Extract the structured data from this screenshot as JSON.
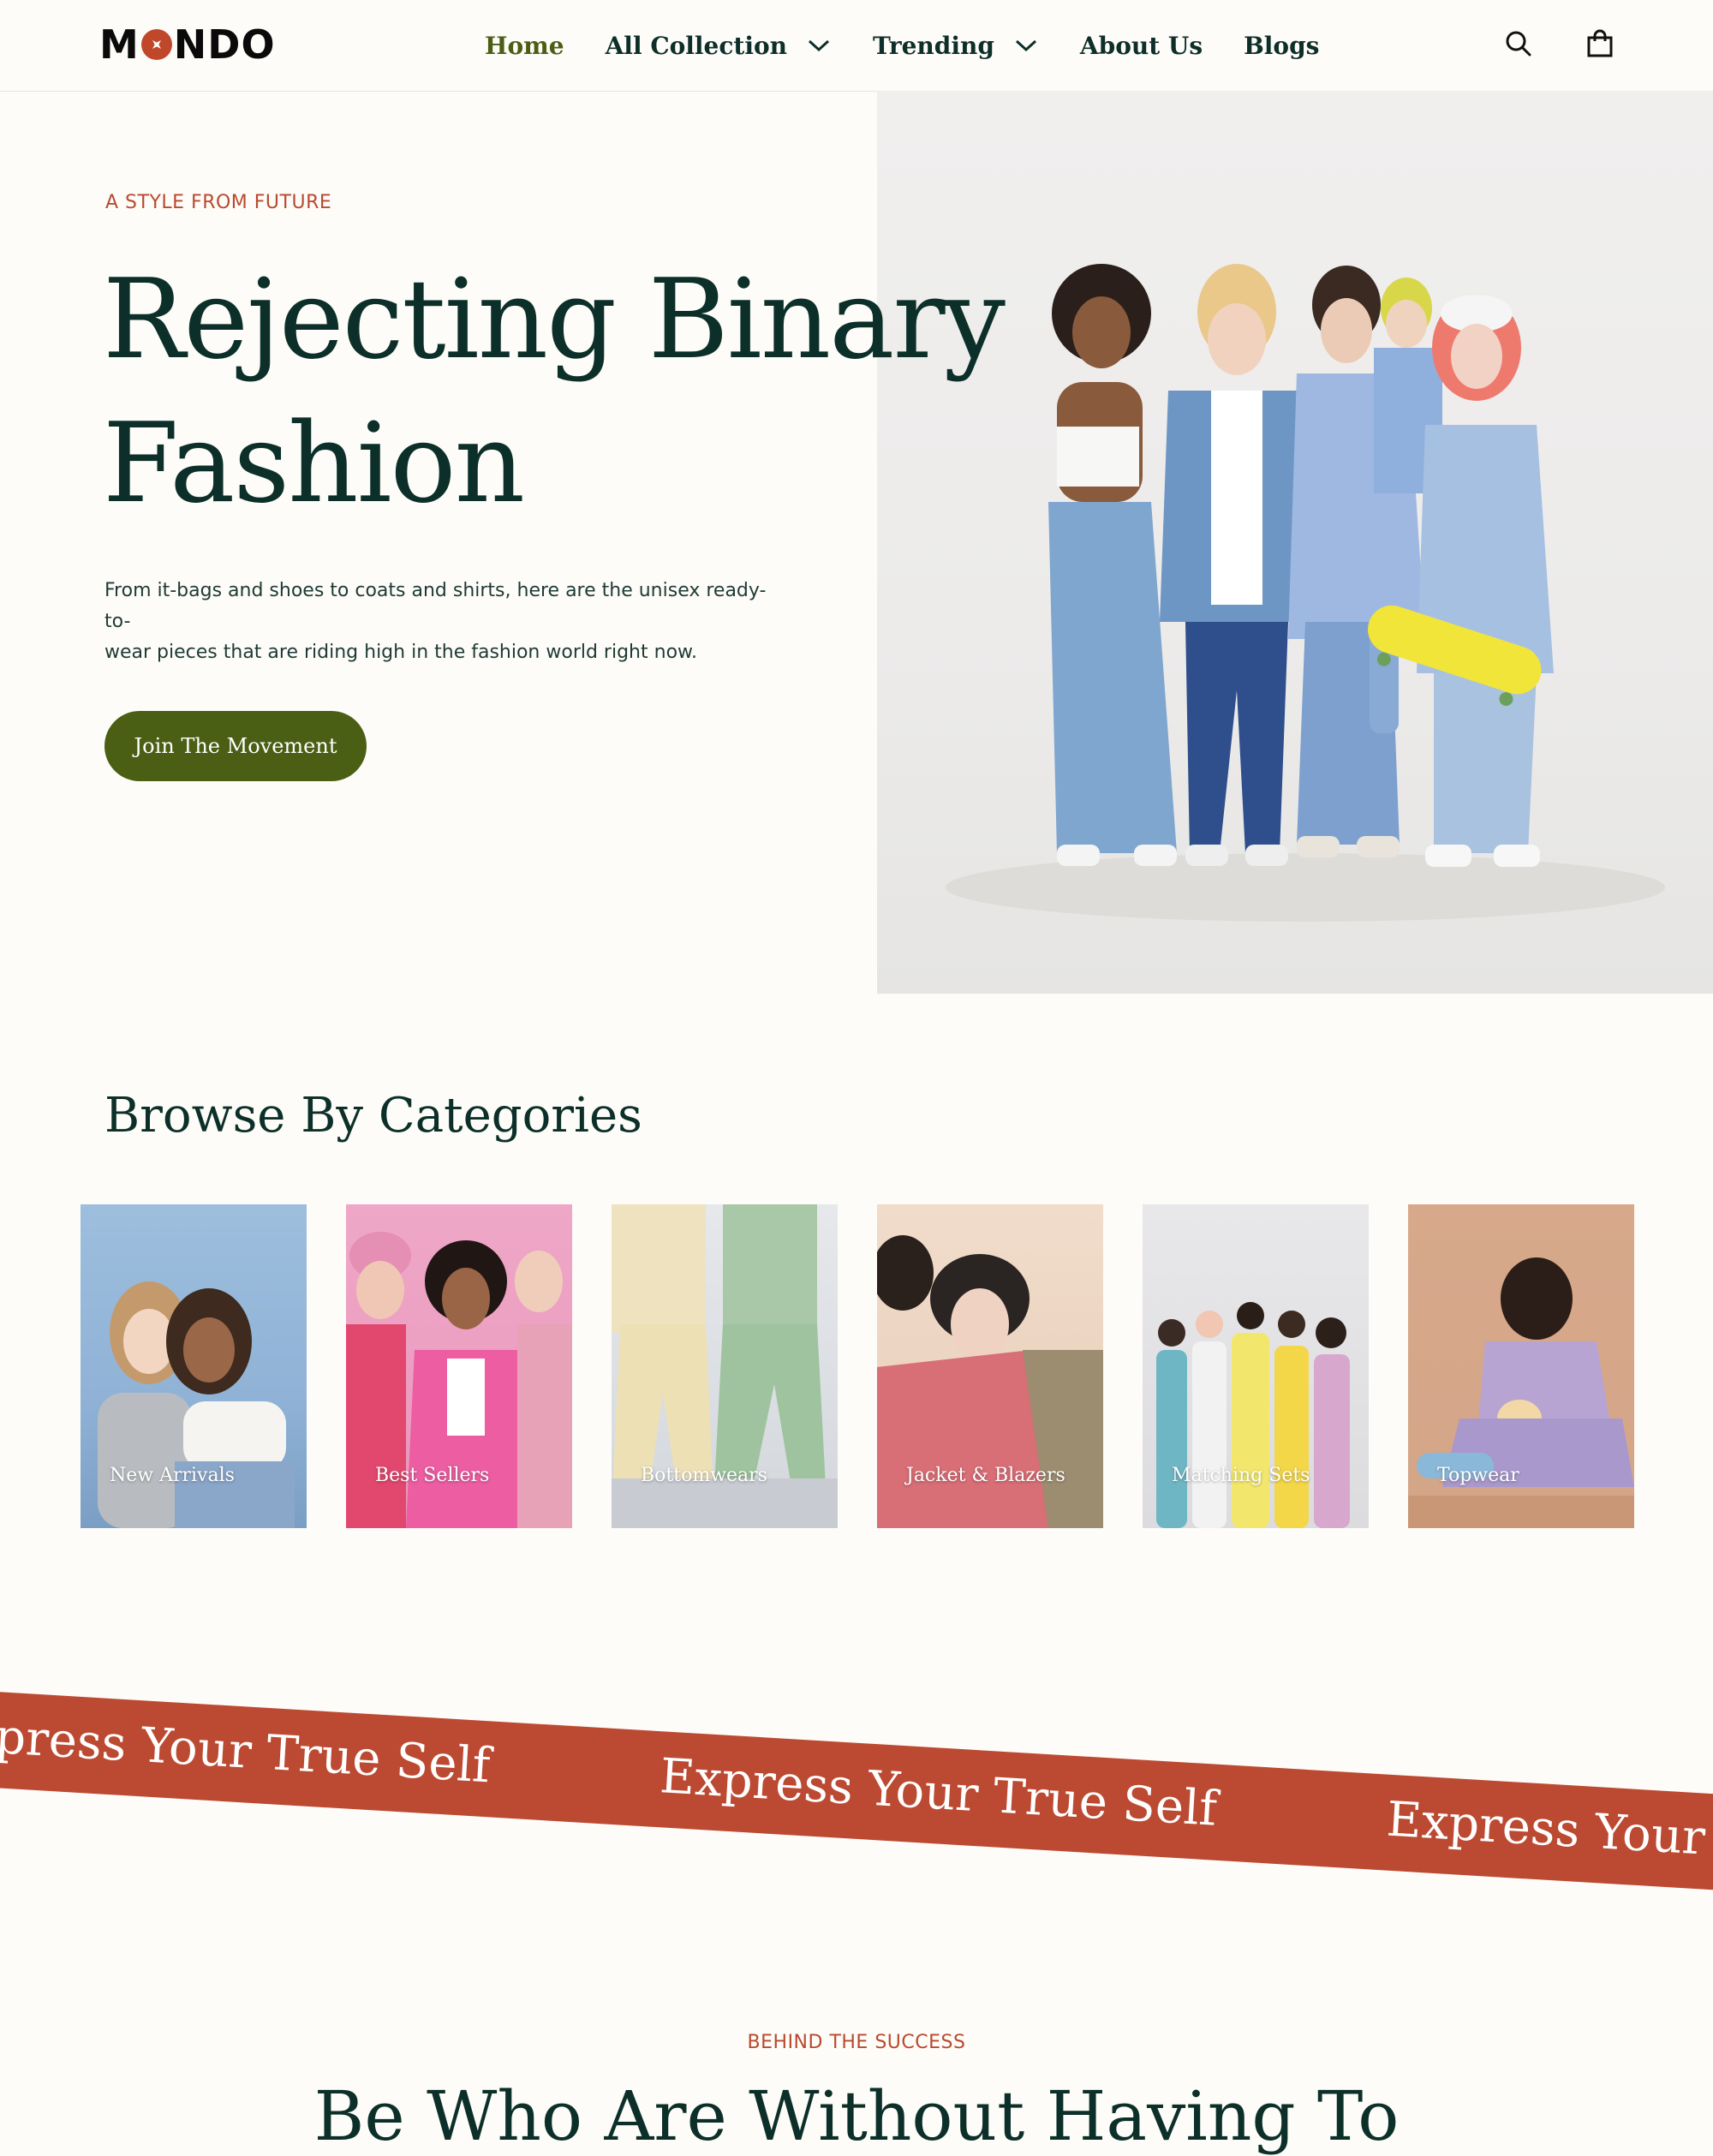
{
  "header": {
    "logo_text_left": "M",
    "logo_text_right": "NDO",
    "nav": [
      {
        "label": "Home",
        "active": true,
        "has_dropdown": false
      },
      {
        "label": "All Collection",
        "active": false,
        "has_dropdown": true
      },
      {
        "label": "Trending",
        "active": false,
        "has_dropdown": true
      },
      {
        "label": "About Us",
        "active": false,
        "has_dropdown": false
      },
      {
        "label": "Blogs",
        "active": false,
        "has_dropdown": false
      }
    ],
    "icons": [
      "search-icon",
      "shopping-bag-icon"
    ]
  },
  "hero": {
    "eyebrow": "A STYLE FROM FUTURE",
    "title_line1": "Rejecting Binary",
    "title_line2": "Fashion",
    "description_line1": "From it-bags and shoes to coats and shirts, here are the unisex ready-to-",
    "description_line2": "wear pieces that are riding high in the fashion world right now.",
    "cta_label": "Join The Movement"
  },
  "categories": {
    "title": "Browse By Categories",
    "items": [
      {
        "label": "New Arrivals"
      },
      {
        "label": "Best Sellers"
      },
      {
        "label": "Bottomwears"
      },
      {
        "label": "Jacket & Blazers"
      },
      {
        "label": "Matching Sets"
      },
      {
        "label": "Topwear"
      }
    ]
  },
  "ribbon": {
    "text": "Express Your True Self"
  },
  "behind": {
    "eyebrow": "BEHIND THE SUCCESS",
    "title": "Be Who Are Without Having To"
  },
  "colors": {
    "background": "#FDFCF8",
    "heading": "#0C3029",
    "accent": "#B94A2E",
    "button": "#4A5E14",
    "ribbon": "#BC4A32"
  }
}
